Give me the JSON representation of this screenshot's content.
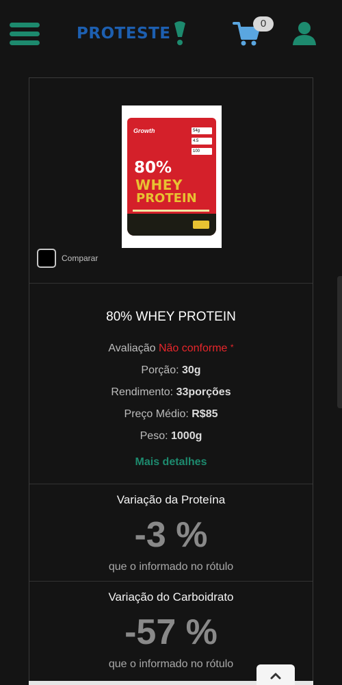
{
  "header": {
    "logo_text": "PROTESTE",
    "cart_count": "0"
  },
  "product": {
    "image": {
      "brand": "Growth",
      "tags": [
        "54g",
        "4.5",
        "100"
      ],
      "line1": "80%",
      "line2": "WHEY",
      "line3": "PROTEIN"
    },
    "compare_label": "Comparar",
    "name": "80% WHEY PROTEIN",
    "rating_label": "Avaliação",
    "rating_value": "Não conforme",
    "rating_mark": "*",
    "portion_label": "Porção:",
    "portion_value": "30g",
    "yield_label": "Rendimento:",
    "yield_value": "33porções",
    "price_label": "Preço Médio:",
    "price_value": "R$85",
    "weight_label": "Peso:",
    "weight_value": "1000g",
    "details_link": "Mais detalhes"
  },
  "metrics": [
    {
      "title": "Variação da Proteína",
      "value": "-3 %",
      "note": "que o informado no rótulo"
    },
    {
      "title": "Variação do Carboidrato",
      "value": "-57 %",
      "note": "que o informado no rótulo"
    }
  ],
  "colors": {
    "accent": "#1d8a6e",
    "logo": "#1d5fb0",
    "cart": "#5aa6e0",
    "nonconform": "#e8262b",
    "background": "#141414"
  },
  "icons": {
    "menu": "hamburger-menu-icon",
    "cart": "shopping-cart-icon",
    "user": "user-icon",
    "back_to_top": "chevron-up-icon"
  }
}
